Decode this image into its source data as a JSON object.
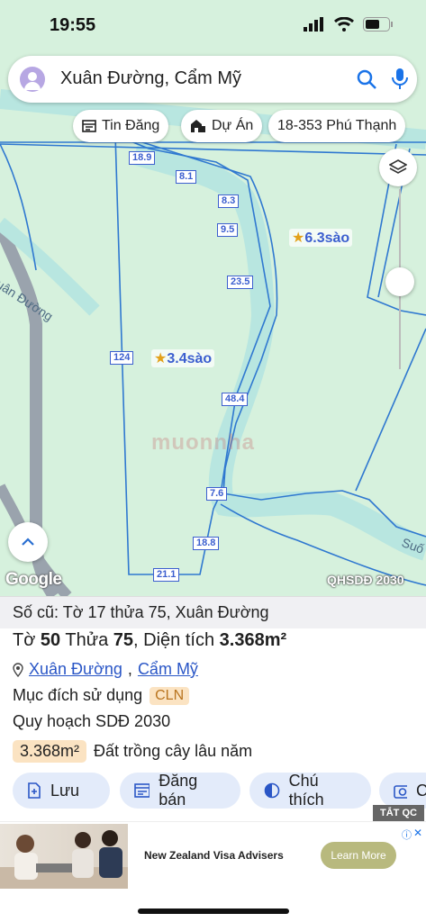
{
  "status": {
    "time": "19:55"
  },
  "search": {
    "query": "Xuân Đường, Cẩm Mỹ"
  },
  "chips": [
    {
      "label": "Tin Đăng"
    },
    {
      "label": "Dự Án"
    },
    {
      "label": "18-353 Phú Thạnh"
    }
  ],
  "map": {
    "segments": [
      "18.9",
      "8.1",
      "8.3",
      "9.5",
      "23.5",
      "124",
      "48.4",
      "7.6",
      "18.8",
      "21.1"
    ],
    "area_left": "3.4sào",
    "area_right": "6.3sào",
    "road_left": "Xuân Đường",
    "road_right": "Suố",
    "watermark": "muonnha",
    "brand": "Google",
    "layer_label": "QHSDĐ 2030"
  },
  "sheet": {
    "old_info": "Số cũ: Tờ 17 thửa 75, Xuân Đường",
    "title_prefix": "Tờ",
    "to_num": "50",
    "thua_label": "Thửa",
    "thua_num": "75",
    "dt_label": ", Diện tích",
    "dt_value": "3.368m²",
    "addr_1": "Xuân Đường",
    "addr_sep": ",",
    "addr_2": "Cẩm Mỹ",
    "purpose_label": "Mục đích sử dụng",
    "purpose_tag": "CLN",
    "plan_label": "Quy hoạch SDĐ 2030",
    "area_tag": "3.368m²",
    "area_desc": "Đất trồng cây lâu năm"
  },
  "actions": [
    {
      "label": "Lưu"
    },
    {
      "label": "Đăng bán"
    },
    {
      "label": "Chú thích"
    },
    {
      "label": "C"
    }
  ],
  "ad": {
    "close_label": "TẮT QC",
    "title": "New Zealand Visa Advisers",
    "cta": "Learn More"
  },
  "colors": {
    "accent": "#3c5fcf",
    "map_bg": "#d6f1dd",
    "road": "#9aa3ad"
  }
}
